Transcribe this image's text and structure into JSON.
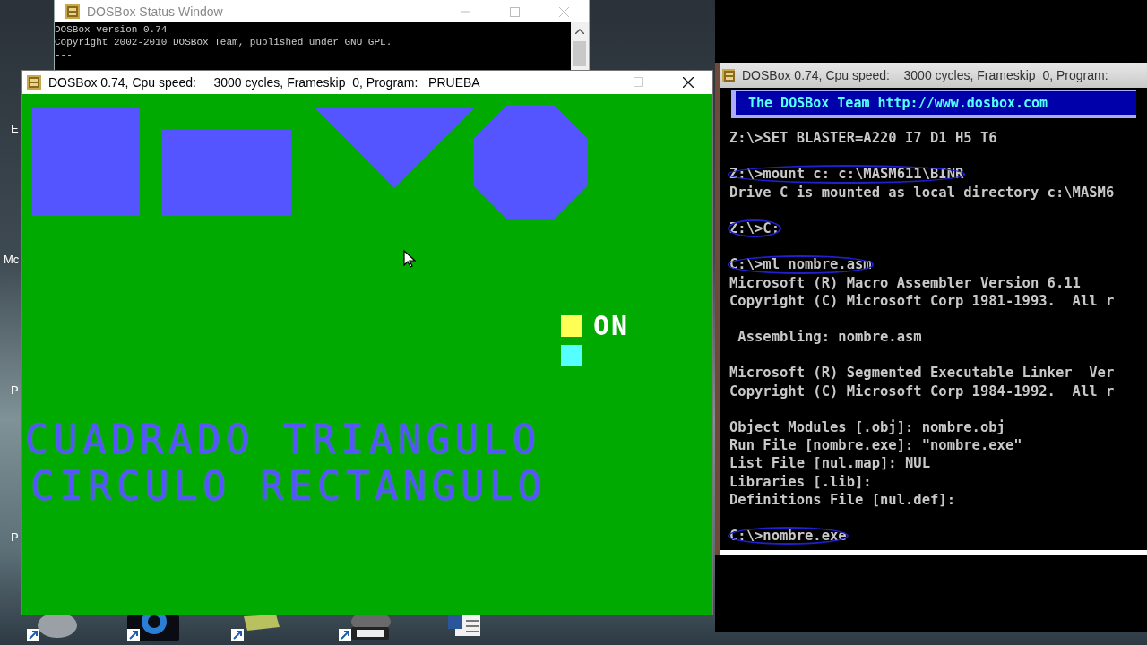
{
  "desktop": {
    "side_labels": [
      "E",
      "Mc",
      "P",
      "P"
    ],
    "shortcuts": [
      {
        "kind": "disc"
      },
      {
        "kind": "player"
      },
      {
        "kind": "folder"
      },
      {
        "kind": "pro"
      },
      {
        "kind": "word"
      }
    ]
  },
  "status_window": {
    "title": "DOSBox Status Window",
    "lines": [
      "DOSBox version 0.74",
      "Copyright 2002-2010 DOSBox Team, published under GNU GPL.",
      "---"
    ]
  },
  "program_window": {
    "title": "DOSBox 0.74, Cpu speed:     3000 cycles, Frameskip  0, Program:   PRUEBA",
    "shapes": [
      {
        "kind": "square"
      },
      {
        "kind": "rectangle"
      },
      {
        "kind": "triangle"
      },
      {
        "kind": "octagon"
      }
    ],
    "indicators": [
      {
        "color": "#ffff55",
        "label": "ON"
      },
      {
        "color": "#55ffff"
      }
    ],
    "words": [
      "CUADRADO TRIANGULO",
      "CIRCULO RECTANGULO"
    ]
  },
  "console_window": {
    "title": "DOSBox 0.74, Cpu speed:    3000 cycles, Frameskip  0, Program:",
    "banner": "The DOSBox Team http://www.dosbox.com",
    "lines": [
      {
        "kind": "text",
        "text": "Z:\\>SET BLASTER=A220 I7 D1 H5 T6",
        "circled": false
      },
      {
        "kind": "blank"
      },
      {
        "kind": "text",
        "text": "Z:\\>mount c: c:\\MASM611\\BINR",
        "circled": true
      },
      {
        "kind": "text",
        "text": "Drive C is mounted as local directory c:\\MASM6",
        "circled": false
      },
      {
        "kind": "blank"
      },
      {
        "kind": "text",
        "text": "Z:\\>C:",
        "circled": true
      },
      {
        "kind": "blank"
      },
      {
        "kind": "text",
        "text": "C:\\>ml nombre.asm",
        "circled": true
      },
      {
        "kind": "text",
        "text": "Microsoft (R) Macro Assembler Version 6.11",
        "circled": false
      },
      {
        "kind": "text",
        "text": "Copyright (C) Microsoft Corp 1981-1993.  All r",
        "circled": false
      },
      {
        "kind": "blank"
      },
      {
        "kind": "text",
        "text": " Assembling: nombre.asm",
        "circled": false
      },
      {
        "kind": "blank"
      },
      {
        "kind": "text",
        "text": "Microsoft (R) Segmented Executable Linker  Ver",
        "circled": false
      },
      {
        "kind": "text",
        "text": "Copyright (C) Microsoft Corp 1984-1992.  All r",
        "circled": false
      },
      {
        "kind": "blank"
      },
      {
        "kind": "text",
        "text": "Object Modules [.obj]: nombre.obj",
        "circled": false
      },
      {
        "kind": "text",
        "text": "Run File [nombre.exe]: \"nombre.exe\"",
        "circled": false
      },
      {
        "kind": "text",
        "text": "List File [nul.map]: NUL",
        "circled": false
      },
      {
        "kind": "text",
        "text": "Libraries [.lib]:",
        "circled": false
      },
      {
        "kind": "text",
        "text": "Definitions File [nul.def]:",
        "circled": false
      },
      {
        "kind": "blank"
      },
      {
        "kind": "text",
        "text": "C:\\>nombre.exe",
        "circled": true
      }
    ]
  }
}
